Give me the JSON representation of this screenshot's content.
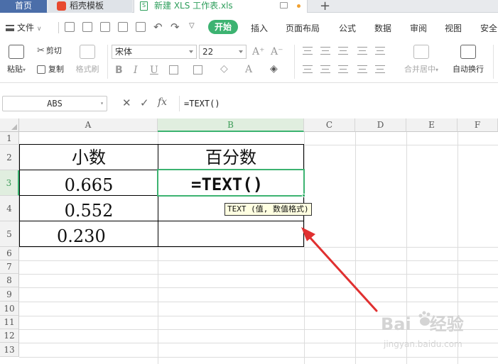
{
  "tabs": {
    "home": "首页",
    "template": "稻壳模板",
    "file": "新建 XLS 工作表.xls",
    "add": "+"
  },
  "menu": {
    "file": "文件",
    "items": [
      "开始",
      "插入",
      "页面布局",
      "公式",
      "数据",
      "审阅",
      "视图",
      "安全"
    ]
  },
  "ribbon": {
    "paste": "粘贴",
    "cut": "剪切",
    "copy": "复制",
    "format_painter": "格式刷",
    "font_name": "宋体",
    "font_size": "22",
    "merge_center": "合并居中",
    "wrap_text": "自动换行"
  },
  "formula_bar": {
    "name_box": "ABS",
    "fx": "fx",
    "formula": "=TEXT()"
  },
  "columns": [
    "A",
    "B",
    "C",
    "D",
    "E",
    "F"
  ],
  "rows": [
    "1",
    "2",
    "3",
    "4",
    "5",
    "6",
    "7",
    "8",
    "9",
    "10",
    "11",
    "12",
    "13"
  ],
  "table": {
    "header_a": "小数",
    "header_b": "百分数",
    "a3": "0.665",
    "a4": "0.552",
    "a5": "0.230",
    "b3": "=TEXT()"
  },
  "tooltip": "TEXT (值, 数值格式)",
  "watermark": {
    "brand": "Bai",
    "brand2": "经验",
    "url": "jingyan.baidu.com"
  },
  "colors": {
    "accent": "#3cb371",
    "home_tab": "#4b6ea9",
    "arrow": "#e03030"
  }
}
